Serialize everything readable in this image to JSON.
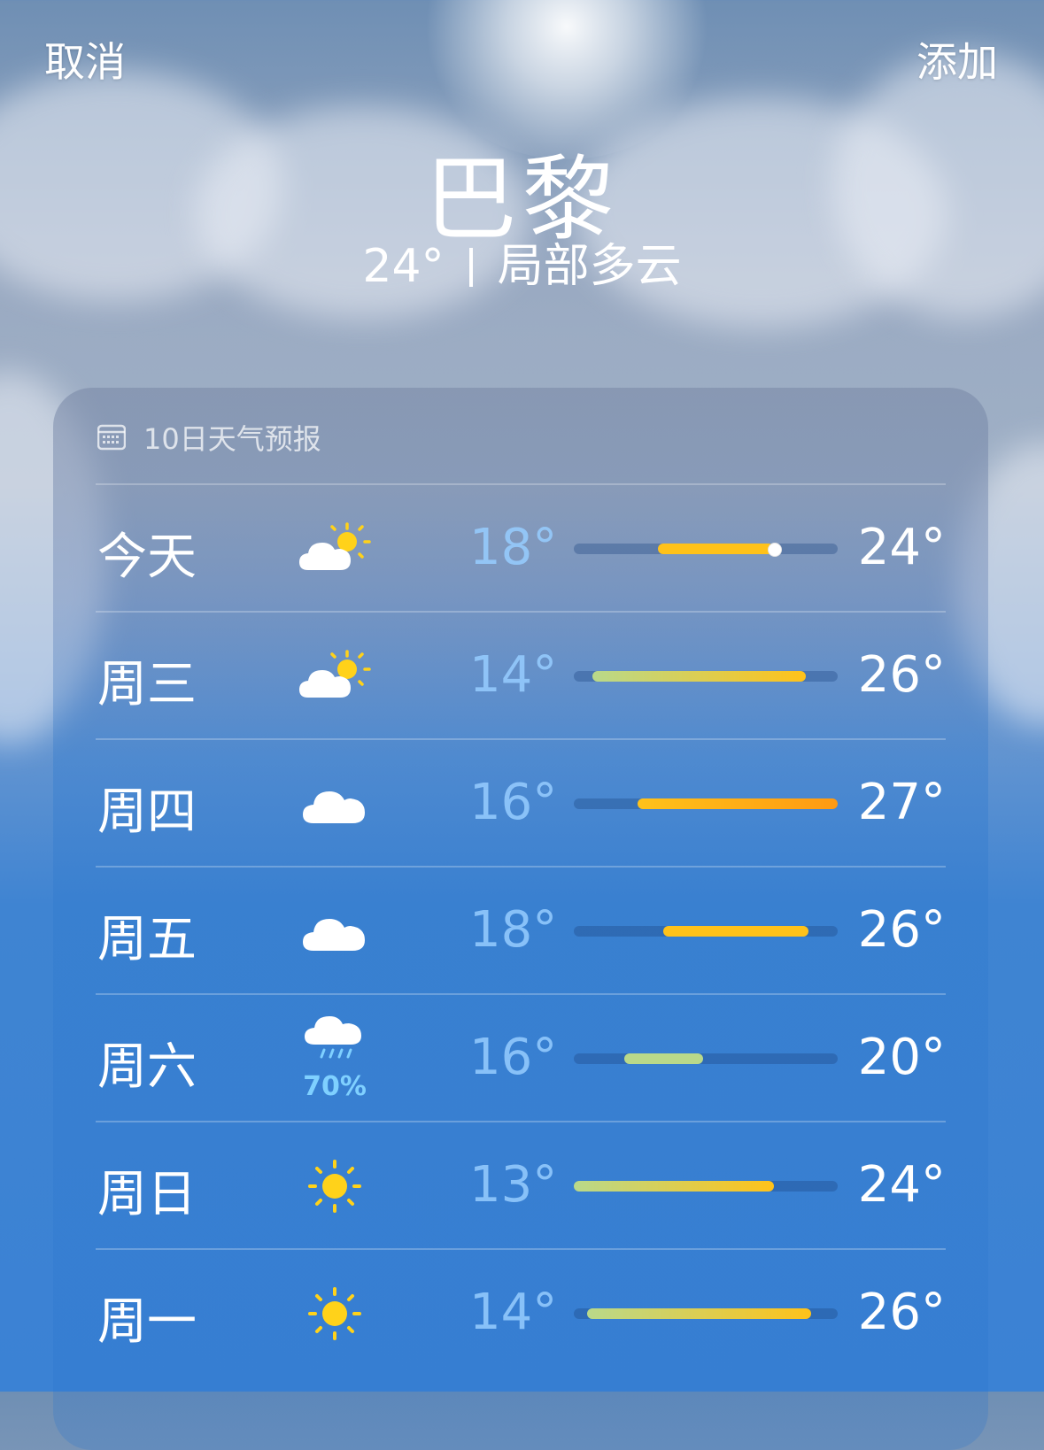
{
  "nav": {
    "cancel": "取消",
    "add": "添加"
  },
  "location": {
    "city": "巴黎",
    "current_temp": "24°",
    "condition": "局部多云"
  },
  "forecast": {
    "header": "10日天气预报",
    "icon": "calendar-icon",
    "days": [
      {
        "day": "今天",
        "icon": "partly-sunny-icon",
        "low": "18°",
        "high": "24°",
        "bar_start": 0.32,
        "bar_end": 0.76,
        "current_pos": 0.76,
        "precip": ""
      },
      {
        "day": "周三",
        "icon": "partly-sunny-icon",
        "low": "14°",
        "high": "26°",
        "bar_start": 0.07,
        "bar_end": 0.88,
        "precip": ""
      },
      {
        "day": "周四",
        "icon": "cloud-icon",
        "low": "16°",
        "high": "27°",
        "bar_start": 0.24,
        "bar_end": 1.0,
        "precip": ""
      },
      {
        "day": "周五",
        "icon": "cloud-icon",
        "low": "18°",
        "high": "26°",
        "bar_start": 0.34,
        "bar_end": 0.89,
        "precip": ""
      },
      {
        "day": "周六",
        "icon": "rain-cloud-icon",
        "low": "16°",
        "high": "20°",
        "bar_start": 0.19,
        "bar_end": 0.49,
        "precip": "70%"
      },
      {
        "day": "周日",
        "icon": "sun-icon",
        "low": "13°",
        "high": "24°",
        "bar_start": 0.0,
        "bar_end": 0.76,
        "precip": ""
      },
      {
        "day": "周一",
        "icon": "sun-icon",
        "low": "14°",
        "high": "26°",
        "bar_start": 0.05,
        "bar_end": 0.9,
        "precip": ""
      }
    ]
  },
  "colors": {
    "cool": "#b9d98a",
    "warm": "#ffc21a",
    "hot": "#ff9a12",
    "precip": "#7fd0ff"
  }
}
